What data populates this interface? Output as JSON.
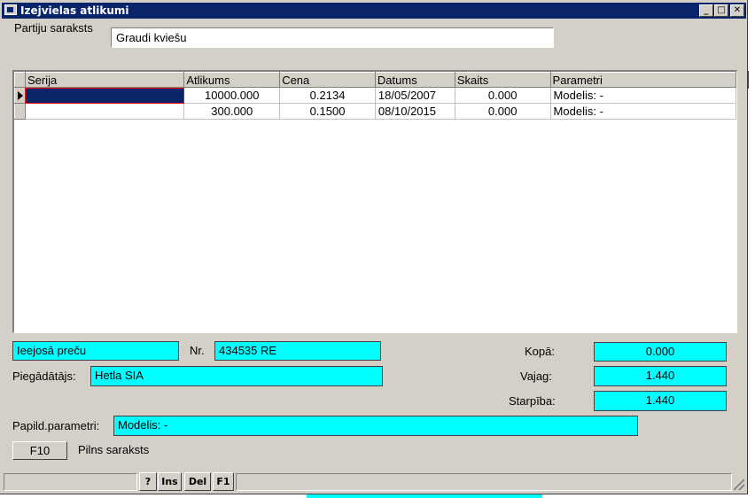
{
  "window": {
    "title": "Izejvielas atlikumi",
    "controls": {
      "minimize": "_",
      "maximize": "□",
      "close": "✕"
    }
  },
  "header": {
    "partiju_label": "Partiju saraksts",
    "partiju_value": "Graudi kviešu"
  },
  "grid": {
    "columns": [
      "Serija",
      "Atlikums",
      "Cena",
      "Datums",
      "Skaits",
      "Parametri"
    ],
    "rows": [
      {
        "serija": "",
        "atlikums": "10000.000",
        "cena": "0.2134",
        "datums": "18/05/2007",
        "skaits": "0.000",
        "parametri": "Modelis:  -",
        "current": true
      },
      {
        "serija": "",
        "atlikums": "300.000",
        "cena": "0.1500",
        "datums": "08/10/2015",
        "skaits": "0.000",
        "parametri": "Modelis:  -",
        "current": false
      }
    ]
  },
  "bottom": {
    "doc_type_value": "Ieejosā preču",
    "nr_label": "Nr.",
    "nr_value": "434535 RE",
    "supplier_label": "Piegādātājs:",
    "supplier_value": "Hetla SIA",
    "kopa_label": "Kopā:",
    "kopa_value": "0.000",
    "vajag_label": "Vajag:",
    "vajag_value": "1.440",
    "starpiba_label": "Starpība:",
    "starpiba_value": "1.440",
    "params_label": "Papild.parametri:",
    "params_value": "Modelis:  -",
    "f10_label": "F10",
    "full_list_label": "Pilns saraksts"
  },
  "statusbar": {
    "help": "?",
    "ins": "Ins",
    "del": "Del",
    "f1": "F1"
  },
  "colors": {
    "title_bg": "#0a246a",
    "face": "#d4d0c8",
    "field_highlight": "#00ffff",
    "selection": "#0a246a"
  }
}
